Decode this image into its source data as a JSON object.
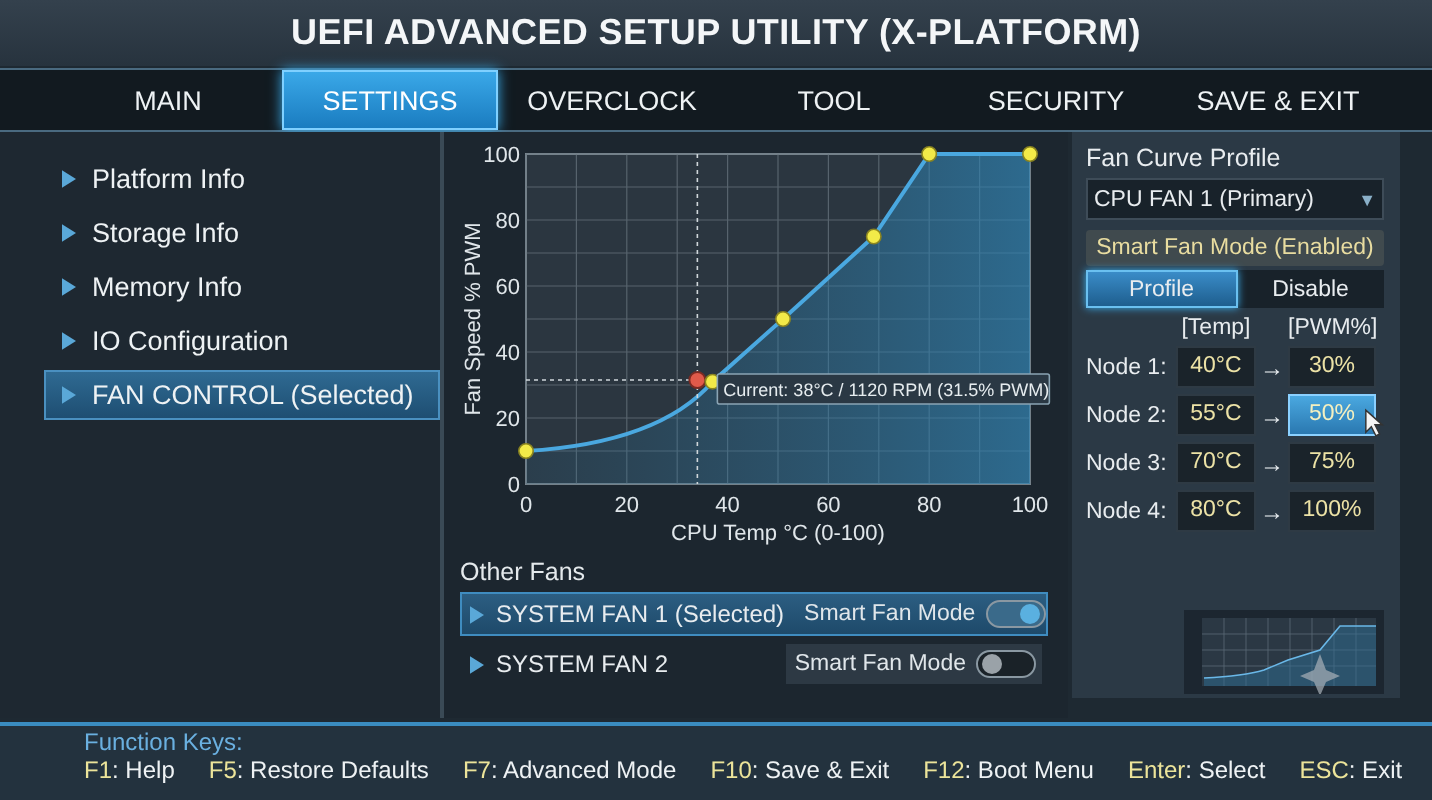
{
  "window": {
    "title": "UEFI ADVANCED SETUP UTILITY (X-PLATFORM)"
  },
  "tabs": [
    {
      "label": "MAIN",
      "selected": false
    },
    {
      "label": "SETTINGS",
      "selected": true
    },
    {
      "label": "OVERCLOCK",
      "selected": false
    },
    {
      "label": "TOOL",
      "selected": false
    },
    {
      "label": "SECURITY",
      "selected": false
    },
    {
      "label": "SAVE & EXIT",
      "selected": false
    }
  ],
  "sidebar": {
    "items": [
      {
        "label": "Platform Info",
        "selected": false
      },
      {
        "label": "Storage Info",
        "selected": false
      },
      {
        "label": "Memory Info",
        "selected": false
      },
      {
        "label": "IO Configuration",
        "selected": false
      },
      {
        "label": "FAN CONTROL (Selected)",
        "selected": true
      }
    ]
  },
  "fan_chart": {
    "chart_data": {
      "type": "area",
      "grid": true,
      "marker": true,
      "xlabel": "CPU Temp °C (0-100)",
      "ylabel": "Fan Speed % PWM",
      "x": [
        0,
        37,
        51,
        69,
        80,
        100
      ],
      "series": [
        {
          "color": "#4aa8e0",
          "values": [
            10,
            31,
            50,
            75,
            100,
            100
          ]
        }
      ],
      "ref_lines": [
        {
          "axis": "x",
          "value": 34
        },
        {
          "axis": "y",
          "value": 31.5
        }
      ],
      "xlim": [
        0,
        100
      ],
      "ylim": [
        0,
        100
      ],
      "xticks": [
        0,
        20,
        40,
        60,
        80,
        100
      ],
      "yticks": [
        0,
        20,
        40,
        60,
        80,
        100
      ],
      "annotations": [
        {
          "text": "Current: 38°C / 1120 RPM (31.5% PWM)",
          "x": 34,
          "y": 31.5
        }
      ]
    }
  },
  "other_fans": {
    "title": "Other Fans",
    "fans": [
      {
        "name": "SYSTEM FAN 1 (Selected)",
        "selected": true,
        "mode_label": "Smart Fan Mode",
        "on": true
      },
      {
        "name": "SYSTEM FAN 2",
        "selected": false,
        "mode_label": "Smart Fan Mode",
        "on": false
      }
    ]
  },
  "profile_panel": {
    "title": "Fan Curve Profile",
    "dropdown": {
      "value": "CPU FAN 1 (Primary)",
      "icon": "▼"
    },
    "mode_label": "Smart Fan Mode (Enabled)",
    "segments": [
      {
        "label": "Profile",
        "selected": true
      },
      {
        "label": "Disable",
        "selected": false
      }
    ],
    "headers": {
      "temp": "[Temp]",
      "pwm": "[PWM%]"
    },
    "nodes": [
      {
        "label": "Node 1:",
        "temp": "40°C",
        "arrow": "→",
        "pwm": "30%",
        "selected": false
      },
      {
        "label": "Node 2:",
        "temp": "55°C",
        "arrow": "→",
        "pwm": "50%",
        "selected": true
      },
      {
        "label": "Node 3:",
        "temp": "70°C",
        "arrow": "→",
        "pwm": "75%",
        "selected": false
      },
      {
        "label": "Node 4:",
        "temp": "80°C",
        "arrow": "→",
        "pwm": "100%",
        "selected": false
      }
    ]
  },
  "footer": {
    "title": "Function Keys:",
    "keys": [
      {
        "key": "F1",
        "action": ": Help"
      },
      {
        "key": "F5",
        "action": ": Restore Defaults"
      },
      {
        "key": "F7",
        "action": ": Advanced Mode"
      },
      {
        "key": "F10",
        "action": ": Save & Exit"
      },
      {
        "key": "F12",
        "action": ": Boot Menu"
      },
      {
        "key": "Enter",
        "action": ": Select"
      },
      {
        "key": "ESC",
        "action": ": Exit"
      }
    ]
  }
}
